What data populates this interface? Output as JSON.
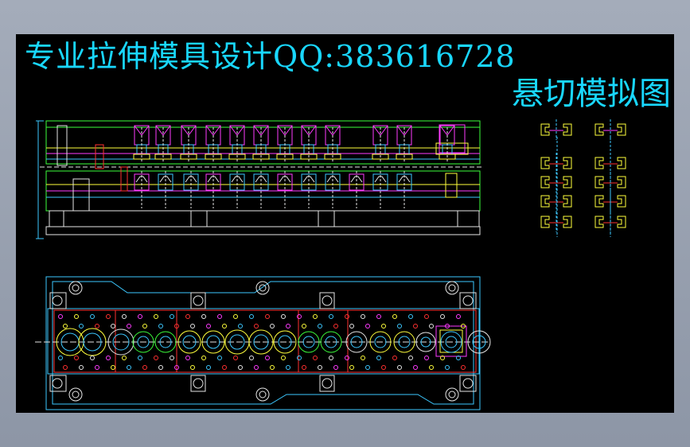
{
  "drawing": {
    "title": "专业拉伸模具设计QQ:383616728",
    "subtitle": "悬切模拟图"
  },
  "colors": {
    "background": "#000000",
    "frame": "#a4acba",
    "title_cyan": "#19d7ff",
    "magenta": "#ff3cff",
    "yellow": "#ffff3c",
    "green": "#3cff3c",
    "red": "#ff3030",
    "cyan": "#3cc8ff",
    "white": "#e6e6e6"
  }
}
